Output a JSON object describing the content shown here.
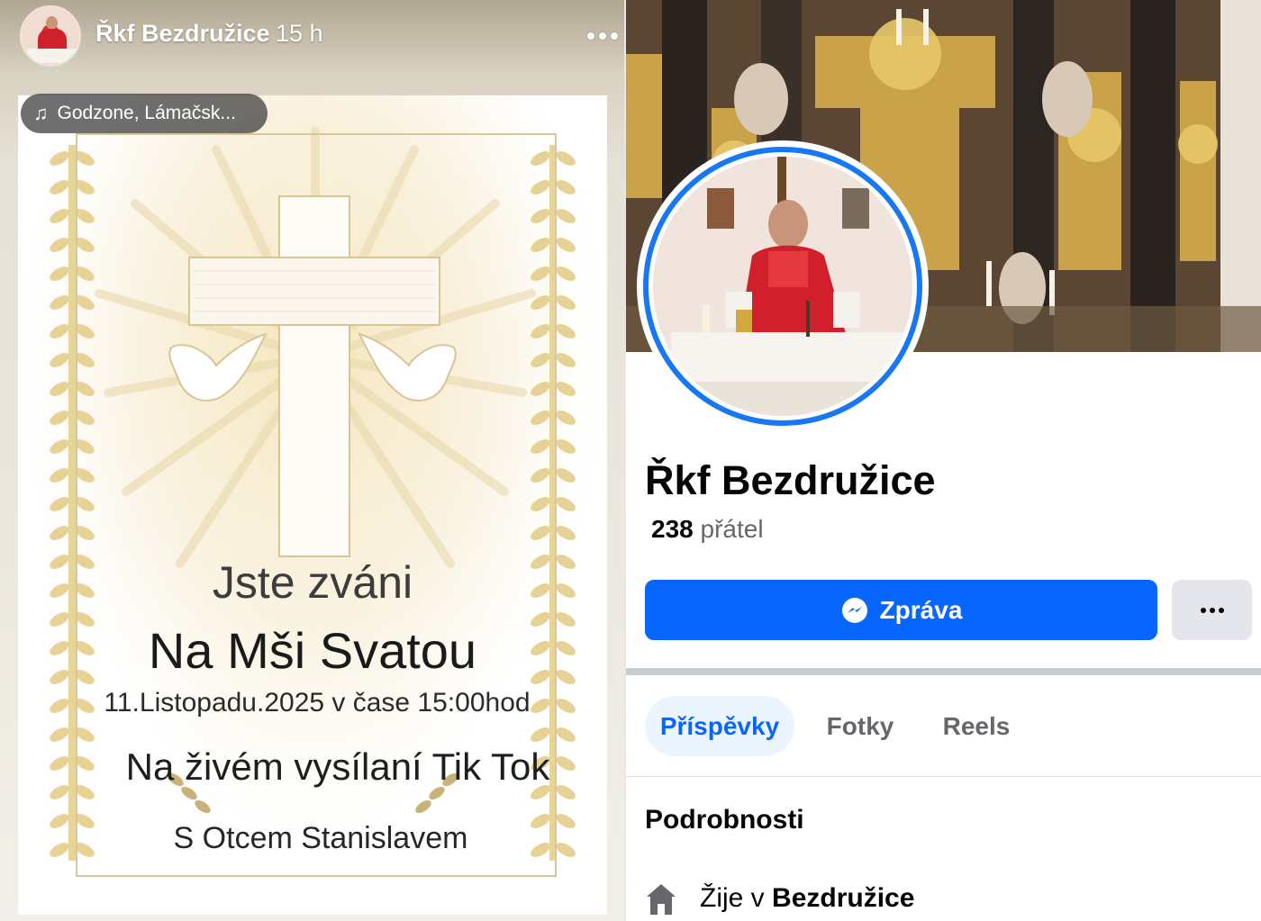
{
  "story": {
    "author_name": "Řkf Bezdružice",
    "time": "15 h",
    "more_icon": "more-dots-icon",
    "music": {
      "icon": "music-note-icon",
      "label": "Godzone, Lámačsk..."
    },
    "invitation": {
      "line1": "Jste zváni",
      "line2": "Na Mši Svatou",
      "line3": "11.Listopadu.2025 v čase 15:00hod",
      "line4": "Na živém vysílaní Tik Tok",
      "line5": "S Otcem Stanislavem"
    }
  },
  "profile": {
    "name": "Řkf Bezdružice",
    "friends_count": "238",
    "friends_label": "přátel",
    "message_button": "Zpráva",
    "more_button_icon": "more-dots-icon",
    "tabs": [
      {
        "label": "Příspěvky",
        "active": true
      },
      {
        "label": "Fotky",
        "active": false
      },
      {
        "label": "Reels",
        "active": false
      }
    ],
    "details_title": "Podrobnosti",
    "lives_prefix": "Žije v",
    "lives_place": "Bezdružice"
  },
  "colors": {
    "primary_blue": "#0866ff",
    "profile_ring": "#1877f2",
    "tab_active_bg": "#ebf5ff",
    "secondary_text": "#65676b",
    "gold_accent": "#d9c79a"
  }
}
